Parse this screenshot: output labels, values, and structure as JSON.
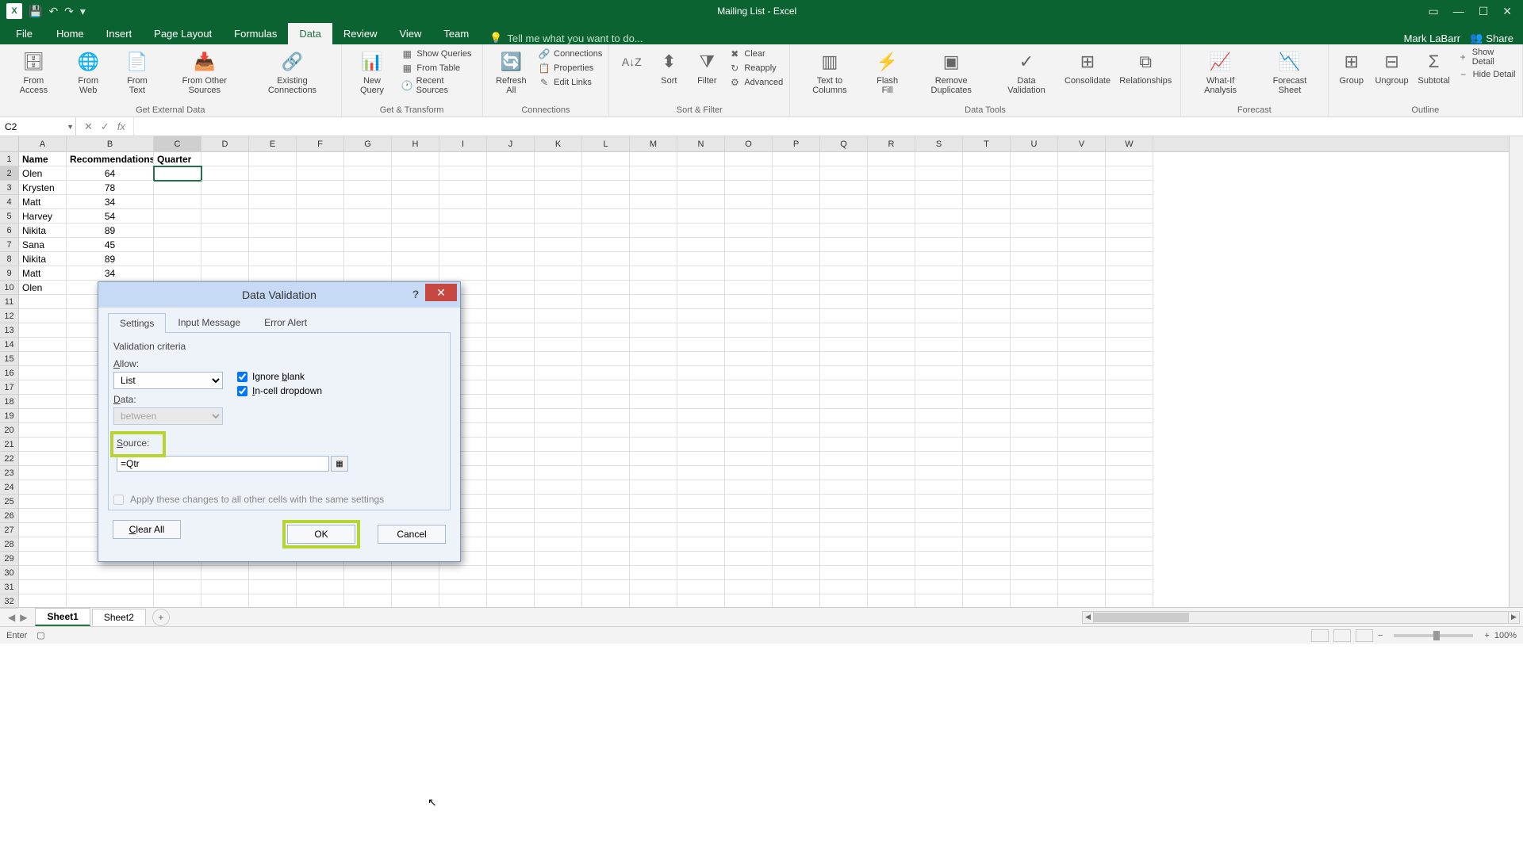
{
  "titlebar": {
    "title": "Mailing List - Excel",
    "excel_icon": "X"
  },
  "ribbon": {
    "user": "Mark LaBarr",
    "share": "Share",
    "file": "File",
    "tabs": [
      "Home",
      "Insert",
      "Page Layout",
      "Formulas",
      "Data",
      "Review",
      "View",
      "Team"
    ],
    "active_tab": "Data",
    "tell_me": "Tell me what you want to do...",
    "groups": {
      "ext_data": {
        "label": "Get External Data",
        "from_access": "From Access",
        "from_web": "From Web",
        "from_text": "From Text",
        "from_other": "From Other Sources",
        "existing": "Existing Connections"
      },
      "get_transform": {
        "label": "Get & Transform",
        "new_query": "New Query",
        "show_queries": "Show Queries",
        "from_table": "From Table",
        "recent": "Recent Sources"
      },
      "connections": {
        "label": "Connections",
        "refresh": "Refresh All",
        "connections": "Connections",
        "properties": "Properties",
        "edit_links": "Edit Links"
      },
      "sort_filter": {
        "label": "Sort & Filter",
        "sort": "Sort",
        "filter": "Filter",
        "clear": "Clear",
        "reapply": "Reapply",
        "advanced": "Advanced"
      },
      "data_tools": {
        "label": "Data Tools",
        "text_cols": "Text to Columns",
        "flash": "Flash Fill",
        "remove_dup": "Remove Duplicates",
        "validation": "Data Validation",
        "consolidate": "Consolidate",
        "relationships": "Relationships"
      },
      "forecast": {
        "label": "Forecast",
        "whatif": "What-If Analysis",
        "forecast": "Forecast Sheet"
      },
      "outline": {
        "label": "Outline",
        "group": "Group",
        "ungroup": "Ungroup",
        "subtotal": "Subtotal",
        "show_detail": "Show Detail",
        "hide_detail": "Hide Detail"
      }
    }
  },
  "namebox": "C2",
  "columns": [
    "A",
    "B",
    "C",
    "D",
    "E",
    "F",
    "G",
    "H",
    "I",
    "J",
    "K",
    "L",
    "M",
    "N",
    "O",
    "P",
    "Q",
    "R",
    "S",
    "T",
    "U",
    "V",
    "W"
  ],
  "headers": {
    "A": "Name",
    "B": "Recommendations",
    "C": "Quarter"
  },
  "data_rows": [
    {
      "A": "Olen",
      "B": "64"
    },
    {
      "A": "Krysten",
      "B": "78"
    },
    {
      "A": "Matt",
      "B": "34"
    },
    {
      "A": "Harvey",
      "B": "54"
    },
    {
      "A": "Nikita",
      "B": "89"
    },
    {
      "A": "Sana",
      "B": "45"
    },
    {
      "A": "Nikita",
      "B": "89"
    },
    {
      "A": "Matt",
      "B": "34"
    },
    {
      "A": "Olen",
      "B": ""
    }
  ],
  "dialog": {
    "title": "Data Validation",
    "tabs": [
      "Settings",
      "Input Message",
      "Error Alert"
    ],
    "criteria_label": "Validation criteria",
    "allow_label": "Allow:",
    "allow_value": "List",
    "data_label": "Data:",
    "data_value": "between",
    "ignore_blank": "Ignore blank",
    "incell": "In-cell dropdown",
    "source_label": "Source:",
    "source_value": "=Qtr",
    "apply_changes": "Apply these changes to all other cells with the same settings",
    "clear_all": "Clear All",
    "ok": "OK",
    "cancel": "Cancel"
  },
  "sheets": [
    "Sheet1",
    "Sheet2"
  ],
  "status": {
    "mode": "Enter",
    "zoom": "100%"
  }
}
